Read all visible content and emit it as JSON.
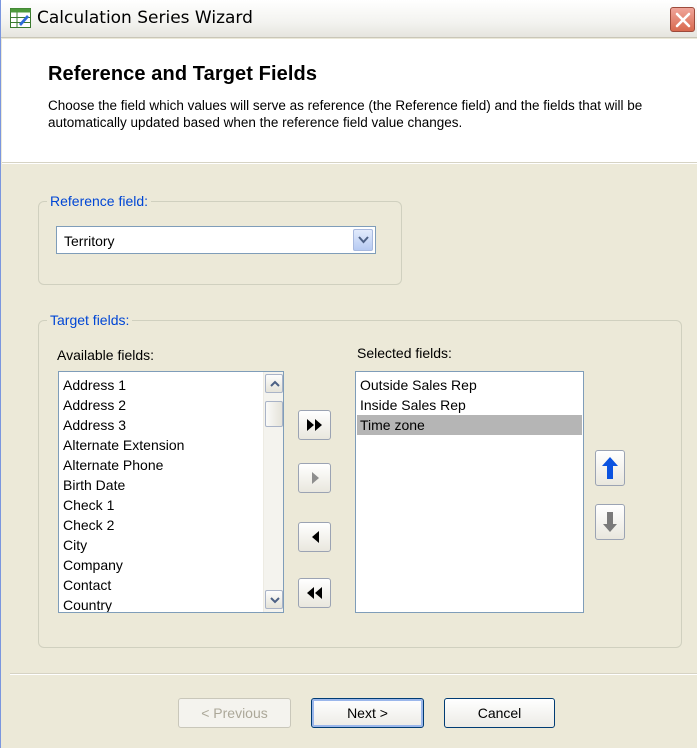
{
  "window": {
    "title": "Calculation Series Wizard",
    "icons": {
      "app": "spreadsheet-wizard-icon",
      "close": "close-x-icon"
    }
  },
  "header": {
    "title": "Reference and Target Fields",
    "description": "Choose the field which values will serve as reference (the Reference field) and the fields that will be automatically updated based when the reference field value changes."
  },
  "reference": {
    "legend": "Reference field:",
    "selected": "Territory",
    "dropdown_icon": "chevron-down-icon"
  },
  "target": {
    "legend": "Target fields:",
    "available_label": "Available fields:",
    "selected_label": "Selected fields:",
    "available_items": [
      "Address 1",
      "Address 2",
      "Address 3",
      "Alternate Extension",
      "Alternate Phone",
      "Birth Date",
      "Check 1",
      "Check 2",
      "City",
      "Company",
      "Contact",
      "Country"
    ],
    "selected_items": [
      "Outside Sales Rep",
      "Inside Sales Rep",
      "Time zone"
    ],
    "highlighted_selected_item": "Time zone",
    "buttons": {
      "add_all": "double-right-arrow-icon",
      "add": "right-arrow-icon",
      "remove": "left-arrow-icon",
      "remove_all": "double-left-arrow-icon",
      "move_up": "up-arrow-icon",
      "move_down": "down-arrow-icon"
    }
  },
  "footer": {
    "previous": "< Previous",
    "next": "Next >",
    "cancel": "Cancel"
  },
  "colors": {
    "accent_blue": "#0046D5",
    "face": "#ECE9D8",
    "selection": "#B5B5B5",
    "arrow_blue": "#0A52E0"
  }
}
